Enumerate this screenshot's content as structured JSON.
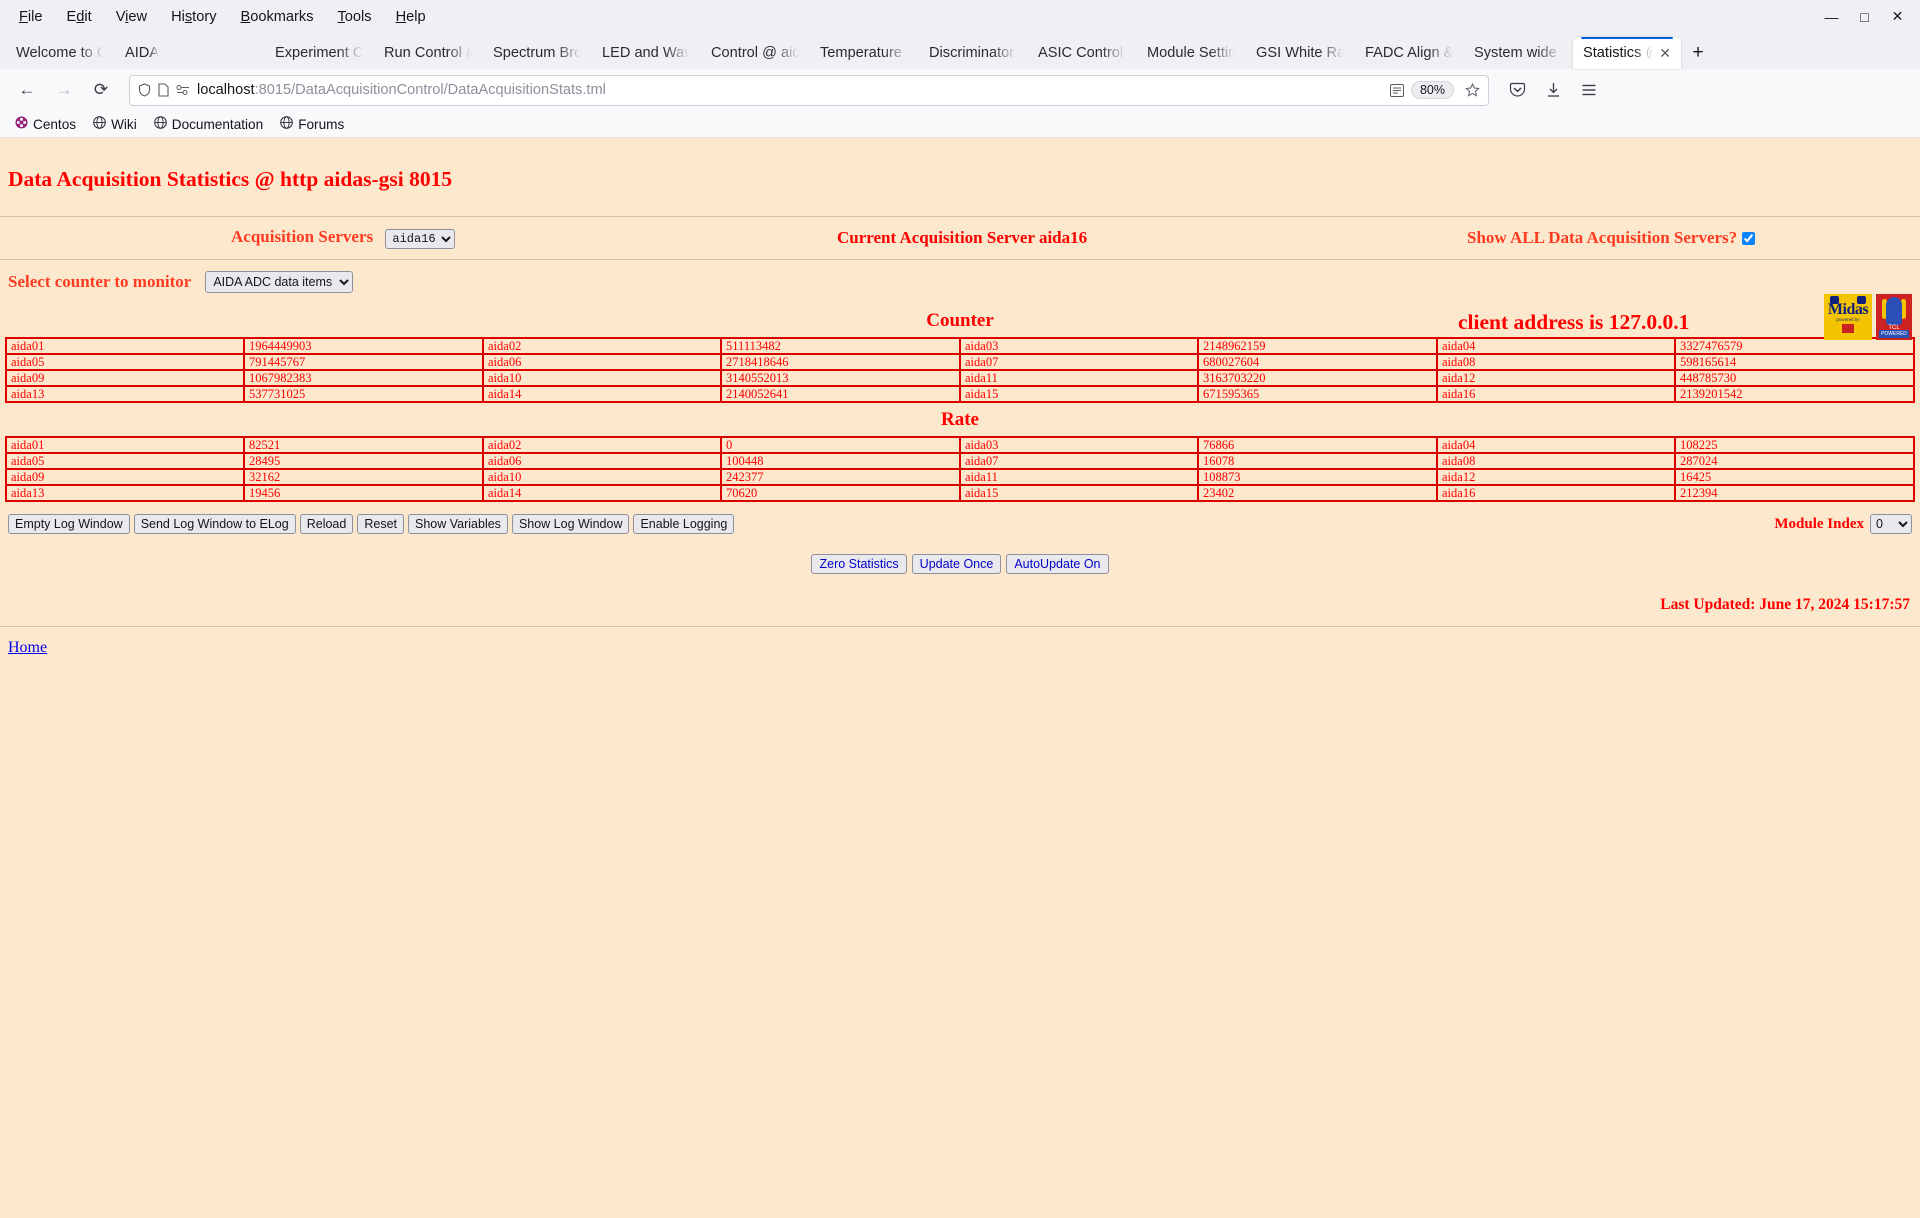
{
  "browser": {
    "menus": [
      "File",
      "Edit",
      "View",
      "History",
      "Bookmarks",
      "Tools",
      "Help"
    ],
    "window_controls": {
      "minimize": "—",
      "maximize": "□",
      "close": "✕"
    },
    "tabs": [
      {
        "label": "Welcome to Cen",
        "active": false
      },
      {
        "label": "AIDA",
        "active": false
      },
      {
        "label": "",
        "active": false
      },
      {
        "label": "Experiment Cont",
        "active": false
      },
      {
        "label": "Run Control @ a",
        "active": false
      },
      {
        "label": "Spectrum Brows",
        "active": false
      },
      {
        "label": "LED and Wavefo",
        "active": false
      },
      {
        "label": "Control @ aidas",
        "active": false
      },
      {
        "label": "Temperature an",
        "active": false
      },
      {
        "label": "Discriminator co",
        "active": false
      },
      {
        "label": "ASIC Control @",
        "active": false
      },
      {
        "label": "Module Settings",
        "active": false
      },
      {
        "label": "GSI White Rabbi",
        "active": false
      },
      {
        "label": "FADC Align & C",
        "active": false
      },
      {
        "label": "System wide Ch",
        "active": false
      },
      {
        "label": "Statistics @ a",
        "active": true
      }
    ],
    "new_tab_label": "+",
    "nav": {
      "back": "←",
      "forward": "→",
      "reload": "⟳"
    },
    "url": {
      "host": "localhost",
      "rest": ":8015/DataAcquisitionControl/DataAcquisitionStats.tml"
    },
    "zoom_level": "80%",
    "bookmarks": [
      {
        "label": "Centos",
        "icon": "centos-icon"
      },
      {
        "label": "Wiki",
        "icon": "globe-icon"
      },
      {
        "label": "Documentation",
        "icon": "globe-icon"
      },
      {
        "label": "Forums",
        "icon": "globe-icon"
      }
    ]
  },
  "page": {
    "title": "Data Acquisition Statistics @ http aidas-gsi 8015",
    "client_address": "client address is 127.0.0.1",
    "logo_midas": {
      "text": "Midas",
      "sub": "powered by"
    },
    "logo_tcl": {
      "text": "TCL",
      "bar": "POWERED"
    },
    "acquisition_servers_label": "Acquisition Servers",
    "acquisition_servers_value": "aida16",
    "current_server_label": "Current Acquisition Server aida16",
    "show_all_label": "Show ALL Data Acquisition Servers?",
    "show_all_checked": true,
    "select_counter_label": "Select counter to monitor",
    "select_counter_value": "AIDA ADC data items",
    "counter_title": "Counter",
    "rate_title": "Rate",
    "counter_rows": [
      [
        [
          "aida01",
          "1964449903"
        ],
        [
          "aida02",
          "511113482"
        ],
        [
          "aida03",
          "2148962159"
        ],
        [
          "aida04",
          "3327476579"
        ]
      ],
      [
        [
          "aida05",
          "791445767"
        ],
        [
          "aida06",
          "2718418646"
        ],
        [
          "aida07",
          "680027604"
        ],
        [
          "aida08",
          "598165614"
        ]
      ],
      [
        [
          "aida09",
          "1067982383"
        ],
        [
          "aida10",
          "3140552013"
        ],
        [
          "aida11",
          "3163703220"
        ],
        [
          "aida12",
          "448785730"
        ]
      ],
      [
        [
          "aida13",
          "537731025"
        ],
        [
          "aida14",
          "2140052641"
        ],
        [
          "aida15",
          "671595365"
        ],
        [
          "aida16",
          "2139201542"
        ]
      ]
    ],
    "rate_rows": [
      [
        [
          "aida01",
          "82521"
        ],
        [
          "aida02",
          "0"
        ],
        [
          "aida03",
          "76866"
        ],
        [
          "aida04",
          "108225"
        ]
      ],
      [
        [
          "aida05",
          "28495"
        ],
        [
          "aida06",
          "100448"
        ],
        [
          "aida07",
          "16078"
        ],
        [
          "aida08",
          "287024"
        ]
      ],
      [
        [
          "aida09",
          "32162"
        ],
        [
          "aida10",
          "242377"
        ],
        [
          "aida11",
          "108873"
        ],
        [
          "aida12",
          "16425"
        ]
      ],
      [
        [
          "aida13",
          "19456"
        ],
        [
          "aida14",
          "70620"
        ],
        [
          "aida15",
          "23402"
        ],
        [
          "aida16",
          "212394"
        ]
      ]
    ],
    "log_buttons": [
      "Empty Log Window",
      "Send Log Window to ELog",
      "Reload",
      "Reset",
      "Show Variables",
      "Show Log Window",
      "Enable Logging"
    ],
    "module_index_label": "Module Index",
    "module_index_value": "0",
    "action_buttons": [
      "Zero Statistics",
      "Update Once",
      "AutoUpdate On"
    ],
    "last_updated": "Last Updated: June 17, 2024 15:17:57",
    "home_link": "Home"
  },
  "colors": {
    "page_bg": "#fce8cd",
    "text_red": "#ff0000",
    "border_red": "#dd0000",
    "link_blue": "#0000ee"
  }
}
